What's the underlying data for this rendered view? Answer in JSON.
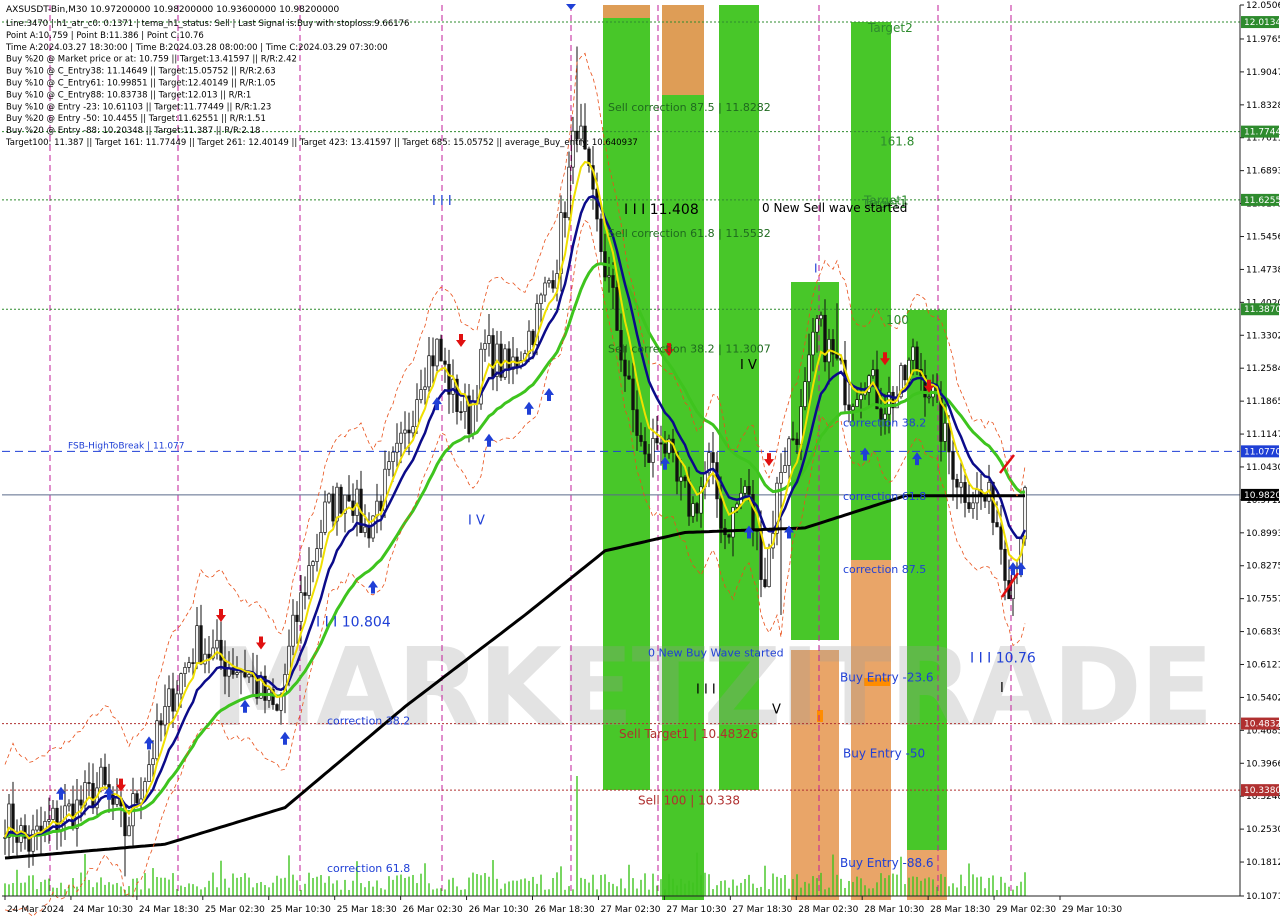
{
  "chart_data": {
    "type": "candlestick",
    "symbol_line": "AXSUSDT-Bin,M30  10.97200000 10.98200000 10.93600000 10.98200000",
    "info_lines": [
      "Line:3470 | h1_atr_c0: 0.1371 | tema_h1_status: Sell | Last Signal is:Buy with stoploss:9.66176",
      "Point A:10.759 | Point B:11.386 | Point C:10.76",
      "Time A:2024.03.27 18:30:00 | Time B:2024.03.28 08:00:00 | Time C:2024.03.29 07:30:00",
      "Buy %20 @ Market price or at: 10.759 || Target:13.41597 || R/R:2.42",
      "Buy %10 @ C_Entry38: 11.14649 || Target:15.05752 || R/R:2.63",
      "Buy %10 @ C_Entry61: 10.99851 || Target:12.40149 || R/R:1.05",
      "Buy %10 @ C_Entry88: 10.83738 || Target:12.013 || R/R:1",
      "Buy %10 @ Entry -23: 10.61103 || Target:11.77449 || R/R:1.23",
      "Buy %20 @ Entry -50: 10.4455 || Target:11.62551 || R/R:1.51",
      "Buy %20 @ Entry -88: 10.20348 || Target:11.387 || R/R:2.18",
      "Target100: 11.387 || Target 161: 11.77449 || Target 261: 12.40149 || Target 423: 13.41597 || Target 685: 15.05752 || average_Buy_entry: 10.640937"
    ],
    "ylim": [
      10.1071,
      12.0506
    ],
    "y_ticks": [
      "12.0506",
      "11.9765",
      "11.9047",
      "11.8328",
      "11.7611",
      "11.6893",
      "11.6175",
      "11.5456",
      "11.4738",
      "11.4020",
      "11.3302",
      "11.2584",
      "11.1865",
      "11.1147",
      "11.0430",
      "10.9712",
      "10.8993",
      "10.8275",
      "10.7557",
      "10.6839",
      "10.6121",
      "10.5402",
      "10.4685",
      "10.3966",
      "10.3248",
      "10.2530",
      "10.1812",
      "10.1071"
    ],
    "x_ticks": [
      "24 Mar 2024",
      "24 Mar 10:30",
      "24 Mar 18:30",
      "25 Mar 02:30",
      "25 Mar 10:30",
      "25 Mar 18:30",
      "26 Mar 02:30",
      "26 Mar 10:30",
      "26 Mar 18:30",
      "27 Mar 02:30",
      "27 Mar 10:30",
      "27 Mar 18:30",
      "28 Mar 02:30",
      "28 Mar 10:30",
      "28 Mar 18:30",
      "29 Mar 02:30",
      "29 Mar 10:30"
    ],
    "price_levels": [
      {
        "value": 12.0134,
        "label": "12.0134",
        "color": "#2e8b2e"
      },
      {
        "value": 11.7744,
        "label": "11.7744",
        "color": "#2e8b2e"
      },
      {
        "value": 11.6255,
        "label": "11.6255",
        "color": "#2e8b2e"
      },
      {
        "value": 11.387,
        "label": "11.3870",
        "color": "#2e8b2e"
      },
      {
        "value": 11.077,
        "label": "11.0770",
        "color": "#1f3fd6"
      },
      {
        "value": 10.982,
        "label": "10.9820",
        "color": "#000000"
      },
      {
        "value": 10.4832,
        "label": "10.4832",
        "color": "#b03030"
      },
      {
        "value": 10.338,
        "label": "10.3380",
        "color": "#b03030"
      }
    ],
    "fsb_label": "FSB-HighToBreak | 11.077",
    "annotations": [
      {
        "text": "Target2",
        "color": "#2e8b2e",
        "value": 12.0
      },
      {
        "text": "Target1",
        "color": "#2e8b2e",
        "value": 11.624
      },
      {
        "text": "Target1",
        "color": "#2e8b2e",
        "value": 11.617
      },
      {
        "text": "161.8",
        "color": "#2e8b2e",
        "value": 11.753
      },
      {
        "text": "100",
        "color": "#2e8b2e",
        "value": 11.364
      },
      {
        "text": "Sell correction 87.5 | 11.8282",
        "color": "#1f6a1f",
        "value": 11.828
      },
      {
        "text": "Sell correction 61.8 | 11.5532",
        "color": "#1f6a1f",
        "value": 11.553
      },
      {
        "text": "Sell correction 38.2 | 11.3007",
        "color": "#1f6a1f",
        "value": 11.301
      },
      {
        "text": "I I I 11.408",
        "color": "#000000",
        "value": 11.603
      },
      {
        "text": "0 New Sell wave started",
        "color": "#000000",
        "value": 11.608
      },
      {
        "text": "I V",
        "color": "#000000",
        "value": 11.265
      },
      {
        "text": "I",
        "color": "#1f3fd6",
        "value": 11.476
      },
      {
        "text": "I I I",
        "color": "#1f3fd6",
        "value": 11.623
      },
      {
        "text": "I V",
        "color": "#1f3fd6",
        "value": 10.926
      },
      {
        "text": "I I I 10.804",
        "color": "#1f3fd6",
        "value": 10.704
      },
      {
        "text": "I I I 10.76",
        "color": "#1f3fd6",
        "value": 10.625
      },
      {
        "text": "I I I",
        "color": "#000000",
        "value": 10.558
      },
      {
        "text": "V",
        "color": "#000000",
        "value": 10.514
      },
      {
        "text": "I",
        "color": "#000000",
        "value": 10.561
      },
      {
        "text": "correction 38.2",
        "color": "#1f3fd6",
        "value": 11.14
      },
      {
        "text": "correction 61.8",
        "color": "#1f3fd6",
        "value": 10.98
      },
      {
        "text": "correction 87.5",
        "color": "#1f3fd6",
        "value": 10.82
      },
      {
        "text": "correction 38.2",
        "color": "#1f3fd6",
        "value": 10.49
      },
      {
        "text": "correction 61.8",
        "color": "#1f3fd6",
        "value": 10.168
      },
      {
        "text": "0 New Buy Wave started",
        "color": "#1f3fd6",
        "value": 10.638
      },
      {
        "text": "Buy Entry -23.6",
        "color": "#1f3fd6",
        "value": 10.584
      },
      {
        "text": "Buy Entry -50",
        "color": "#1f3fd6",
        "value": 10.418
      },
      {
        "text": "Buy Entry -88.6",
        "color": "#1f3fd6",
        "value": 10.179
      },
      {
        "text": "Sell Target1 | 10.48326",
        "color": "#b03030",
        "value": 10.461
      },
      {
        "text": "Sell 100 | 10.338",
        "color": "#b03030",
        "value": 10.315
      }
    ],
    "watermark": "MARKETZITRADE",
    "vertical_markers_count": 9
  }
}
